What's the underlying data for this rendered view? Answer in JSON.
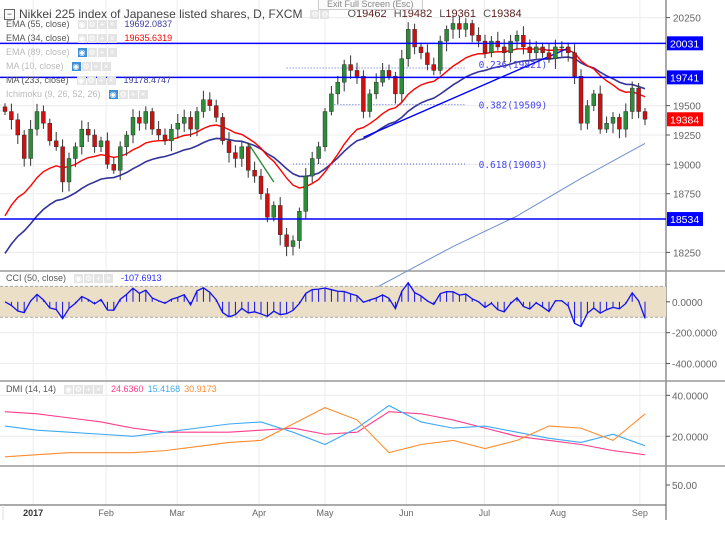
{
  "header": {
    "title": "Nikkei 225 index of Japanese listed shares, D, FXCM",
    "exit_fullscreen": "Exit Full Screen (Esc)",
    "ohlc": {
      "o_label": "O",
      "o": "19462",
      "h_label": "H",
      "h": "19482",
      "l_label": "L",
      "l": "19361",
      "c_label": "C",
      "c": "19384"
    }
  },
  "legend": [
    {
      "name": "EMA (55, close)",
      "value": "19692.0837",
      "color": "#3b3b9c",
      "hidden": false
    },
    {
      "name": "EMA (34, close)",
      "value": "19635.6319",
      "color": "#ff0000",
      "hidden": false
    },
    {
      "name": "EMA (89, close)",
      "value": "",
      "color": "",
      "hidden": true
    },
    {
      "name": "MA (10, close)",
      "value": "",
      "color": "",
      "hidden": true
    },
    {
      "name": "MA (233, close)",
      "value": "19178.4747",
      "color": "#3b3b9c",
      "hidden": false
    },
    {
      "name": "Ichimoku (9, 26, 52, 26)",
      "value": "",
      "color": "",
      "hidden": true
    }
  ],
  "cci_legend": {
    "name": "CCI (50, close)",
    "value": "-107.6913",
    "color": "#2a2aff"
  },
  "dmi_legend": {
    "name": "DMI (14, 14)",
    "values": [
      "24.6360",
      "15.4168",
      "30.9173"
    ],
    "colors": [
      "#ff3d8b",
      "#3fa9f5",
      "#ff8c2e"
    ]
  },
  "colors": {
    "up": "#2e8b3a",
    "down": "#cc1111",
    "hline": "#0000ff",
    "ema34": "#ff0000",
    "ema55": "#33339a",
    "ma233": "#6f8fd0",
    "cci": "#1010ee",
    "band": "#ecdfc8",
    "last": "#ff0000"
  },
  "chart_data": [
    {
      "type": "candlestick",
      "title": "Nikkei 225 index of Japanese listed shares, D, FXCM",
      "ylim": [
        18100,
        20400
      ],
      "y_ticks": [
        20250,
        19500,
        19250,
        19000,
        18750,
        18250
      ],
      "x_ticks": [
        {
          "label": "2017",
          "at": 4.4,
          "bold": true
        },
        {
          "label": "Feb",
          "at": 15.8
        },
        {
          "label": "Mar",
          "at": 26.9
        },
        {
          "label": "Apr",
          "at": 39.7
        },
        {
          "label": "May",
          "at": 50
        },
        {
          "label": "Jun",
          "at": 62.7
        },
        {
          "label": "Jul",
          "at": 74.9
        },
        {
          "label": "Aug",
          "at": 86.4
        },
        {
          "label": "Sep",
          "at": 99.2
        }
      ],
      "closes": [
        19450,
        19380,
        19250,
        19050,
        19300,
        19450,
        19350,
        19200,
        19150,
        18850,
        19050,
        19150,
        19300,
        19250,
        19150,
        19200,
        19000,
        18950,
        19150,
        19250,
        19400,
        19350,
        19450,
        19300,
        19250,
        19200,
        19300,
        19350,
        19400,
        19300,
        19450,
        19550,
        19500,
        19400,
        19200,
        19100,
        19050,
        19150,
        18950,
        18900,
        18750,
        18550,
        18650,
        18400,
        18300,
        18350,
        18600,
        18900,
        19050,
        19150,
        19450,
        19600,
        19700,
        19850,
        19800,
        19750,
        19450,
        19600,
        19700,
        19800,
        19750,
        19600,
        19900,
        20150,
        20000,
        19950,
        19850,
        19800,
        20050,
        20150,
        20200,
        20150,
        20200,
        20100,
        20050,
        19950,
        20050,
        20000,
        19950,
        20050,
        20100,
        20000,
        19950,
        20000,
        19950,
        19900,
        20000,
        20000,
        19950,
        19750,
        19350,
        19500,
        19600,
        19300,
        19350,
        19400,
        19300,
        19450,
        19650,
        19450,
        19384
      ],
      "ema34_seed": 18450,
      "ema55_seed": 18150,
      "ma233_points": [
        [
          58,
          17950
        ],
        [
          70,
          18300
        ],
        [
          80,
          18560
        ],
        [
          90,
          18880
        ],
        [
          100,
          19178
        ]
      ],
      "horizontal_levels": [
        {
          "value": 20031,
          "label": "20031"
        },
        {
          "value": 19741,
          "label": "19741"
        },
        {
          "value": 18534,
          "label": "18534"
        }
      ],
      "last_price": {
        "value": 19384,
        "label": "19384"
      },
      "fib_levels": [
        {
          "label": "0.236(19821)",
          "value": 19821,
          "from": 44,
          "to": 72
        },
        {
          "label": "0.382(19509)",
          "value": 19509,
          "from": 51,
          "to": 72
        },
        {
          "label": "0.618(19003)",
          "value": 19003,
          "from": 45,
          "to": 72
        }
      ],
      "trendlines": [
        {
          "from": [
            56,
            19230
          ],
          "to": [
            88,
            19990
          ],
          "color": "#0000ff"
        },
        {
          "from": [
            38,
            19180
          ],
          "to": [
            42,
            18850
          ],
          "color": "#2e8b3a"
        }
      ]
    },
    {
      "type": "bar",
      "title": "CCI (50, close)",
      "ylim": [
        -513,
        193
      ],
      "y_ticks": [
        {
          "value": 0,
          "label": "0.0000"
        },
        {
          "value": -200,
          "label": "-200.0000"
        },
        {
          "value": -400,
          "label": "-400.0000"
        }
      ],
      "band": [
        -100,
        100
      ]
    },
    {
      "type": "line",
      "title": "DMI (14, 14)",
      "ylim": [
        5.5,
        47
      ],
      "y_ticks": [
        {
          "value": 40,
          "label": "40.0000"
        },
        {
          "value": 20,
          "label": "20.0000"
        }
      ],
      "x_step": 5,
      "series": [
        {
          "name": "ADX",
          "color": "#ff3d8b",
          "values": [
            32,
            31,
            29,
            27,
            24,
            22,
            22,
            22,
            23,
            24,
            21,
            22,
            32,
            31,
            28,
            24,
            20,
            18,
            16,
            13,
            11
          ]
        },
        {
          "name": "+DI",
          "color": "#3fa9f5",
          "values": [
            25,
            23,
            22,
            21,
            20,
            22,
            24,
            26,
            27,
            22,
            16,
            24,
            35,
            27,
            24,
            25,
            22,
            19,
            17,
            21,
            15.4
          ]
        },
        {
          "name": "-DI",
          "color": "#ff8c2e",
          "values": [
            10,
            11,
            12,
            12,
            12,
            13,
            15,
            17,
            18,
            26,
            34,
            28,
            12,
            16,
            18,
            14,
            18,
            25,
            24,
            18,
            30.9
          ]
        }
      ]
    },
    {
      "type": "line",
      "title": "",
      "y_ticks": [
        {
          "value": 50,
          "label": "50.00"
        }
      ]
    }
  ]
}
